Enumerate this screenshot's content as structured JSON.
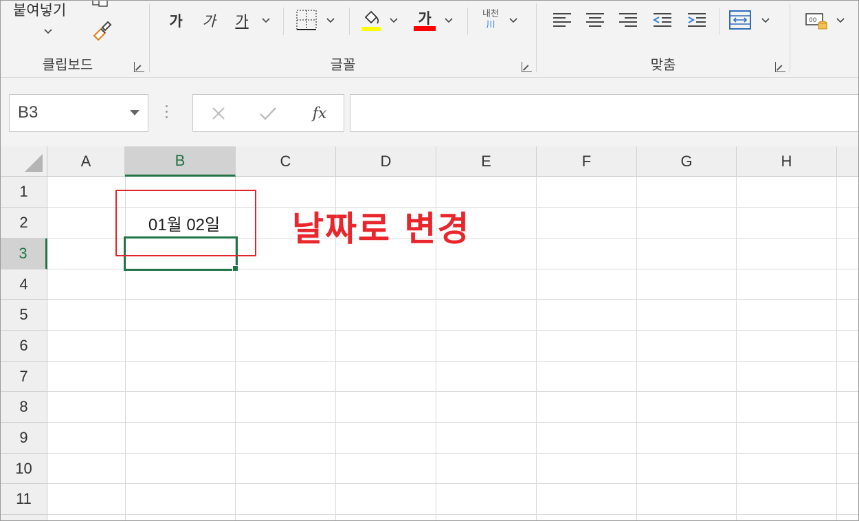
{
  "ribbon": {
    "clipboard": {
      "label": "클립보드",
      "paste_label": "붙여넣기"
    },
    "font": {
      "label": "글꼴",
      "bold_label": "가",
      "italic_label": "가",
      "underline_label": "가",
      "font_color_label": "가",
      "phonetic_label": "내천",
      "phonetic_sub": "川",
      "fill_color": "#ffff00",
      "font_color": "#ff0000"
    },
    "alignment": {
      "label": "맞춤"
    }
  },
  "formula_bar": {
    "name_box": "B3",
    "fx_label": "fx",
    "value": ""
  },
  "sheet": {
    "columns": [
      "A",
      "B",
      "C",
      "D",
      "E",
      "F",
      "G",
      "H"
    ],
    "rows": [
      "1",
      "2",
      "3",
      "4",
      "5",
      "6",
      "7",
      "8",
      "9",
      "10",
      "11"
    ],
    "active_cell": "B3",
    "cells": {
      "B2": "01월 02일"
    }
  },
  "annotation": {
    "text": "날짜로 변경",
    "color": "#e8262c"
  },
  "colors": {
    "excel_green": "#217346"
  }
}
